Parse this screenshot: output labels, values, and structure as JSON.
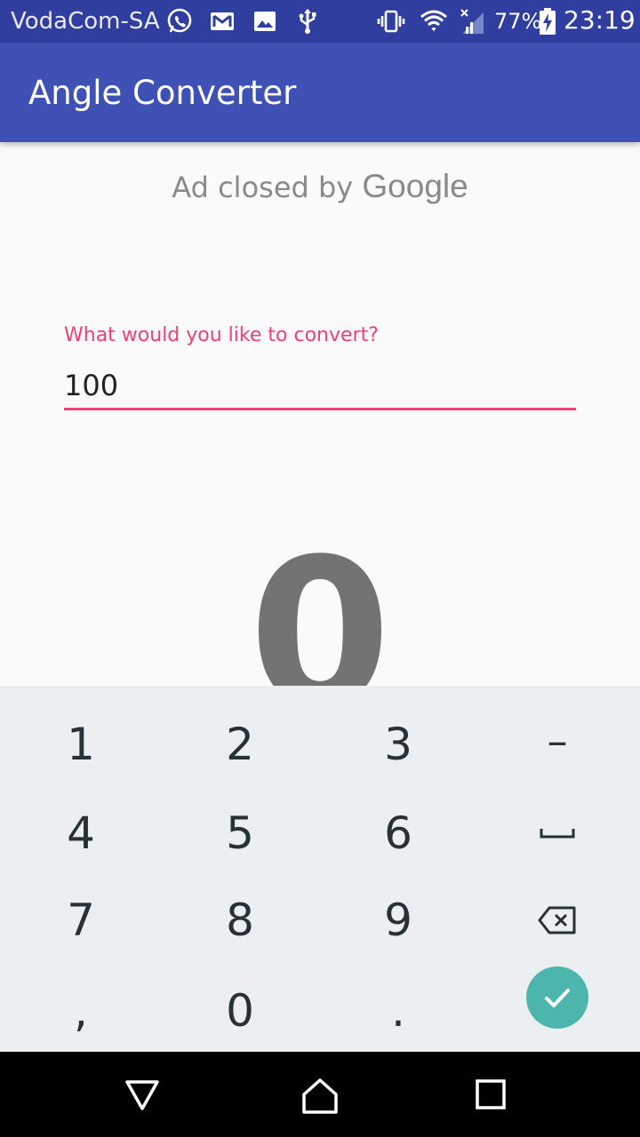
{
  "status_bar": {
    "carrier": "VodaCom-SA",
    "battery_percent": "77%",
    "time": "23:19",
    "icons": [
      "whatsapp-icon",
      "gmail-icon",
      "gallery-icon",
      "usb-icon",
      "vibrate-icon",
      "wifi-icon",
      "signal-icon",
      "battery-charging-icon"
    ]
  },
  "app_bar": {
    "title": "Angle Converter"
  },
  "ad": {
    "text": "Ad closed by ",
    "brand": "Google"
  },
  "input": {
    "label": "What would you like to convert?",
    "value": "100"
  },
  "result": {
    "value": "0"
  },
  "keyboard": {
    "keys": {
      "k1": "1",
      "k2": "2",
      "k3": "3",
      "minus": "–",
      "k4": "4",
      "k5": "5",
      "k6": "6",
      "k7": "7",
      "k8": "8",
      "k9": "9",
      "comma": ",",
      "k0": "0",
      "period": "."
    },
    "special_icons": [
      "space-icon",
      "backspace-icon",
      "done-check-icon"
    ]
  },
  "nav_bar": {
    "icons": [
      "back-icon",
      "home-icon",
      "recents-icon"
    ]
  },
  "colors": {
    "status_bar": "#303f9f",
    "app_bar": "#3f51b5",
    "accent": "#ec407a",
    "done_button": "#4db6ac",
    "keyboard_bg": "#eceff1",
    "result_text": "#737373"
  }
}
